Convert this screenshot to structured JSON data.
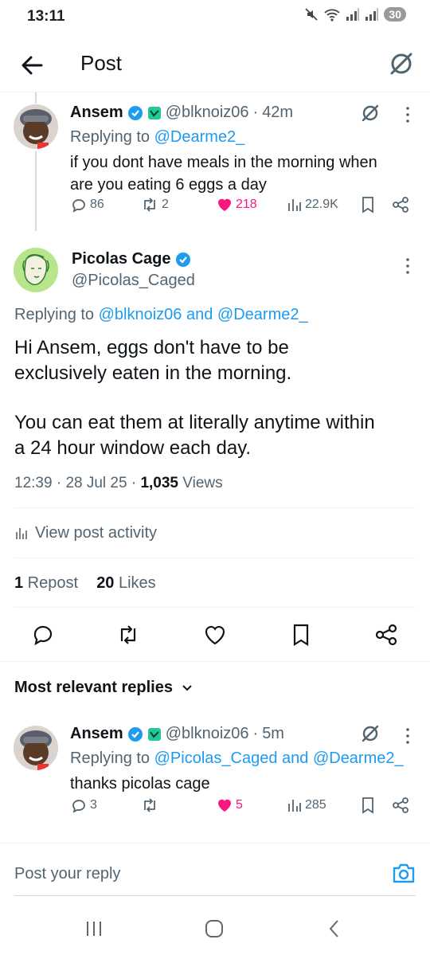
{
  "status_bar": {
    "time": "13:11",
    "battery": "30"
  },
  "header": {
    "title": "Post"
  },
  "reply_parent": {
    "name": "Ansem",
    "handle": "@blknoiz06",
    "sep": "·",
    "time": "42m",
    "replying_prefix": "Replying to ",
    "replying_to": "@Dearme2_",
    "text_line1": "if you dont have meals in the morning when",
    "text_line2": "are you eating 6 eggs a day",
    "replies": "86",
    "reposts": "2",
    "likes": "218",
    "views": "22.9K"
  },
  "main_post": {
    "name": "Picolas Cage",
    "handle": "@Picolas_Caged",
    "replying_prefix": "Replying to ",
    "replying_to": "@blknoiz06 and @Dearme2_",
    "paragraph1_line1": "Hi Ansem, eggs don't have to be",
    "paragraph1_line2": "exclusively eaten in the morning.",
    "paragraph2_line1": "You can eat them at literally anytime within",
    "paragraph2_line2": "a 24 hour window each day.",
    "time": "12:39",
    "date": "28 Jul 25",
    "sep": "·",
    "views_count": "1,035",
    "views_label": " Views",
    "activity_label": "View post activity",
    "reposts_count": "1",
    "reposts_label": " Repost",
    "likes_count": "20",
    "likes_label": " Likes"
  },
  "replies_section": {
    "sort_label": "Most relevant replies"
  },
  "reply": {
    "name": "Ansem",
    "handle": "@blknoiz06",
    "sep": "·",
    "time": "5m",
    "replying_prefix": "Replying to ",
    "replying_to": "@Picolas_Caged and @Dearme2_",
    "text": "thanks picolas cage",
    "replies": "3",
    "reposts": "",
    "likes": "5",
    "views": "285"
  },
  "composer": {
    "placeholder": "Post your reply"
  },
  "colors": {
    "accent": "#1d9bf0",
    "like": "#f91880",
    "muted": "#536471"
  }
}
